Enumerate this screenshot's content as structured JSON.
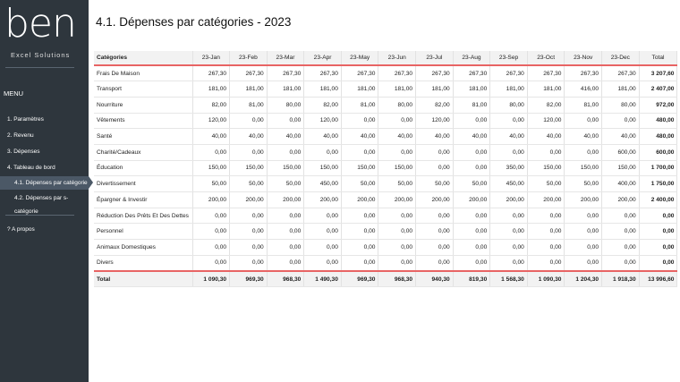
{
  "sidebar": {
    "logo": "ben",
    "tagline": "Excel Solutions",
    "menu_label": "MENU",
    "items": [
      {
        "label": "1. Paramètres"
      },
      {
        "label": "2. Revenu"
      },
      {
        "label": "3. Dépenses"
      },
      {
        "label": "4. Tableau de bord"
      },
      {
        "label": "4.1. Dépenses par catégorie",
        "active": true
      },
      {
        "label": "4.2. Dépenses par s-catégorie"
      },
      {
        "label": "?  A propos"
      }
    ]
  },
  "page": {
    "title": "4.1. Dépenses par catégories - 2023"
  },
  "table": {
    "headers": [
      "Catégories",
      "23-Jan",
      "23-Feb",
      "23-Mar",
      "23-Apr",
      "23-May",
      "23-Jun",
      "23-Jul",
      "23-Aug",
      "23-Sep",
      "23-Oct",
      "23-Nov",
      "23-Dec",
      "Total"
    ],
    "rows": [
      [
        "Frais De Maison",
        "267,30",
        "267,30",
        "267,30",
        "267,30",
        "267,30",
        "267,30",
        "267,30",
        "267,30",
        "267,30",
        "267,30",
        "267,30",
        "267,30",
        "3 207,60"
      ],
      [
        "Transport",
        "181,00",
        "181,00",
        "181,00",
        "181,00",
        "181,00",
        "181,00",
        "181,00",
        "181,00",
        "181,00",
        "181,00",
        "416,00",
        "181,00",
        "2 407,00"
      ],
      [
        "Nourriture",
        "82,00",
        "81,00",
        "80,00",
        "82,00",
        "81,00",
        "80,00",
        "82,00",
        "81,00",
        "80,00",
        "82,00",
        "81,00",
        "80,00",
        "972,00"
      ],
      [
        "Vêtements",
        "120,00",
        "0,00",
        "0,00",
        "120,00",
        "0,00",
        "0,00",
        "120,00",
        "0,00",
        "0,00",
        "120,00",
        "0,00",
        "0,00",
        "480,00"
      ],
      [
        "Santé",
        "40,00",
        "40,00",
        "40,00",
        "40,00",
        "40,00",
        "40,00",
        "40,00",
        "40,00",
        "40,00",
        "40,00",
        "40,00",
        "40,00",
        "480,00"
      ],
      [
        "Charité/Cadeaux",
        "0,00",
        "0,00",
        "0,00",
        "0,00",
        "0,00",
        "0,00",
        "0,00",
        "0,00",
        "0,00",
        "0,00",
        "0,00",
        "600,00",
        "600,00"
      ],
      [
        "Éducation",
        "150,00",
        "150,00",
        "150,00",
        "150,00",
        "150,00",
        "150,00",
        "0,00",
        "0,00",
        "350,00",
        "150,00",
        "150,00",
        "150,00",
        "1 700,00"
      ],
      [
        "Divertissement",
        "50,00",
        "50,00",
        "50,00",
        "450,00",
        "50,00",
        "50,00",
        "50,00",
        "50,00",
        "450,00",
        "50,00",
        "50,00",
        "400,00",
        "1 750,00"
      ],
      [
        "Épargner & Investir",
        "200,00",
        "200,00",
        "200,00",
        "200,00",
        "200,00",
        "200,00",
        "200,00",
        "200,00",
        "200,00",
        "200,00",
        "200,00",
        "200,00",
        "2 400,00"
      ],
      [
        "Réduction Des Prêts Et Des Dettes",
        "0,00",
        "0,00",
        "0,00",
        "0,00",
        "0,00",
        "0,00",
        "0,00",
        "0,00",
        "0,00",
        "0,00",
        "0,00",
        "0,00",
        "0,00"
      ],
      [
        "Personnel",
        "0,00",
        "0,00",
        "0,00",
        "0,00",
        "0,00",
        "0,00",
        "0,00",
        "0,00",
        "0,00",
        "0,00",
        "0,00",
        "0,00",
        "0,00"
      ],
      [
        "Animaux Domestiques",
        "0,00",
        "0,00",
        "0,00",
        "0,00",
        "0,00",
        "0,00",
        "0,00",
        "0,00",
        "0,00",
        "0,00",
        "0,00",
        "0,00",
        "0,00"
      ],
      [
        "Divers",
        "0,00",
        "0,00",
        "0,00",
        "0,00",
        "0,00",
        "0,00",
        "0,00",
        "0,00",
        "0,00",
        "0,00",
        "0,00",
        "0,00",
        "0,00"
      ]
    ],
    "total_row": [
      "Total",
      "1 090,30",
      "969,30",
      "968,30",
      "1 490,30",
      "969,30",
      "968,30",
      "940,30",
      "819,30",
      "1 568,30",
      "1 090,30",
      "1 204,30",
      "1 918,30",
      "13 996,60"
    ]
  }
}
